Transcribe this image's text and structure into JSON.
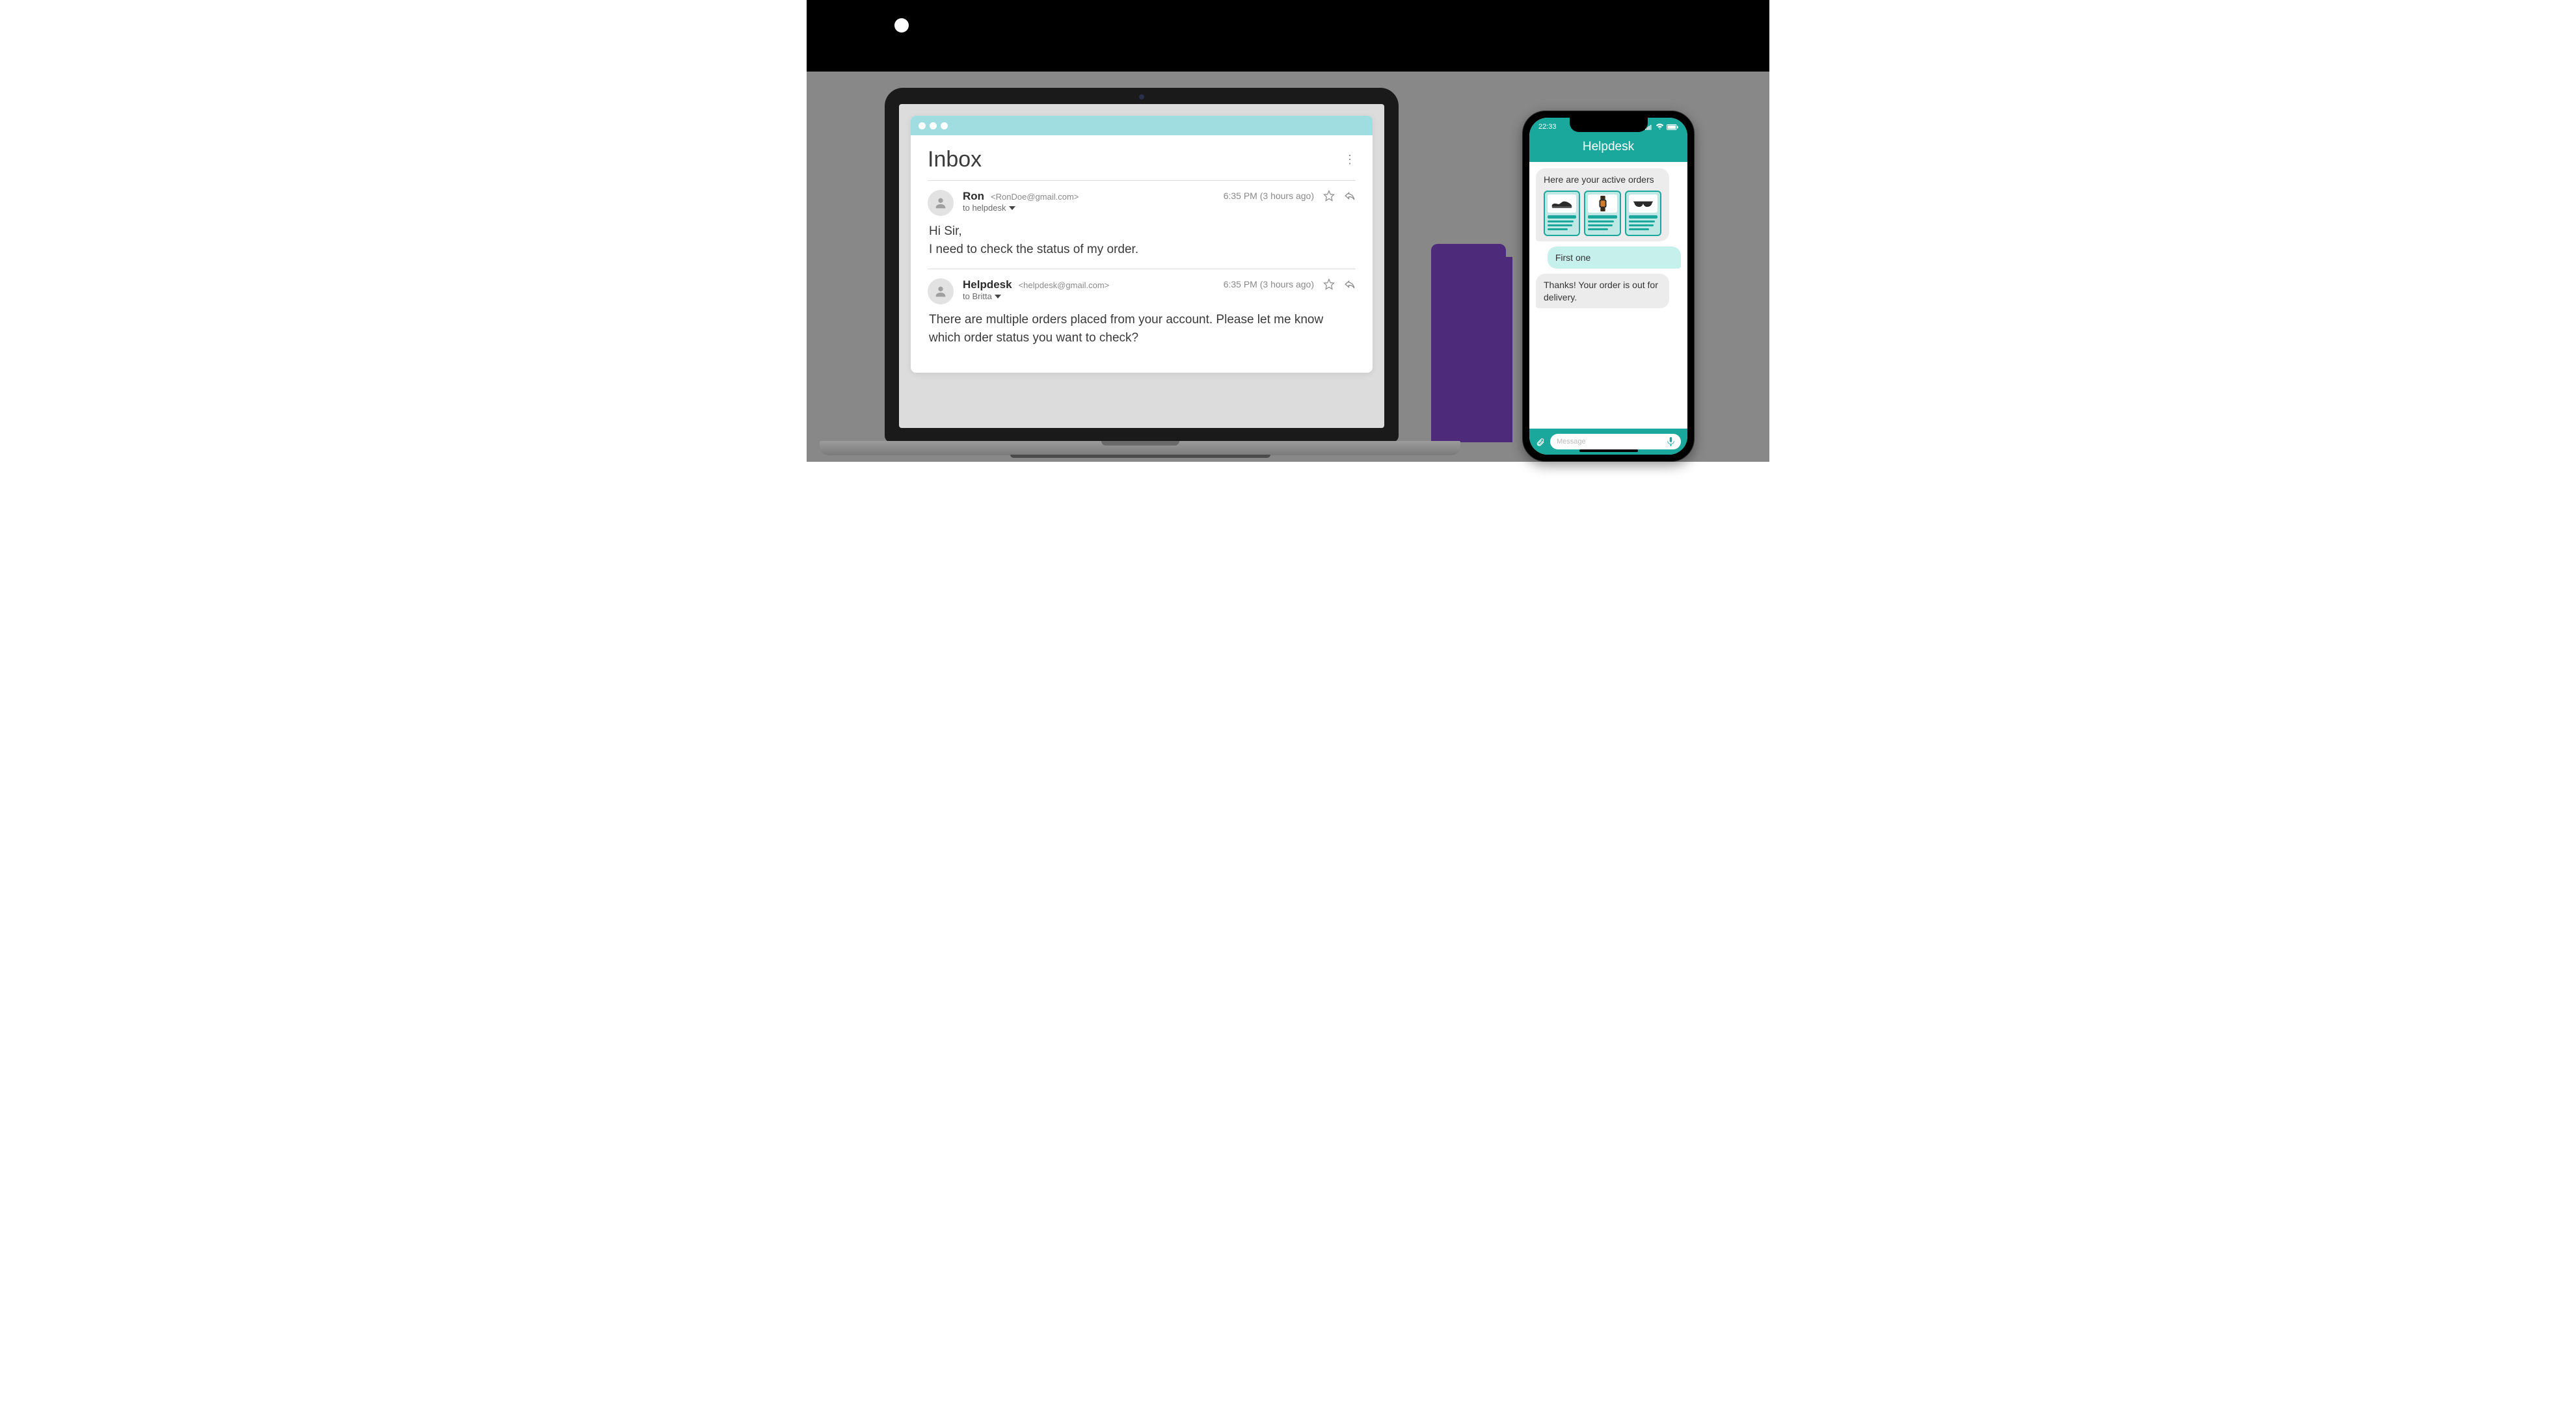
{
  "email": {
    "inbox_title": "Inbox",
    "threads": [
      {
        "sender": "Ron",
        "address": "<RonDoe@gmail.com>",
        "to_line": "to helpdesk",
        "timestamp": "6:35 PM (3 hours ago)",
        "body": "Hi Sir,\nI need to check the status of my order."
      },
      {
        "sender": "Helpdesk",
        "address": "<helpdesk@gmail.com>",
        "to_line": "to Britta",
        "timestamp": "6:35 PM (3 hours ago)",
        "body": "There are multiple orders placed from your account. Please let me know which order status you want to check?"
      }
    ]
  },
  "phone": {
    "status_time": "22:33",
    "header_title": "Helpdesk",
    "messages": {
      "bot1": "Here are your active orders",
      "user1": "First one",
      "bot2": "Thanks! Your order is out for delivery."
    },
    "cards": [
      {
        "icon": "shoe-icon"
      },
      {
        "icon": "watch-icon"
      },
      {
        "icon": "sunglasses-icon"
      }
    ],
    "compose_placeholder": "Message"
  }
}
